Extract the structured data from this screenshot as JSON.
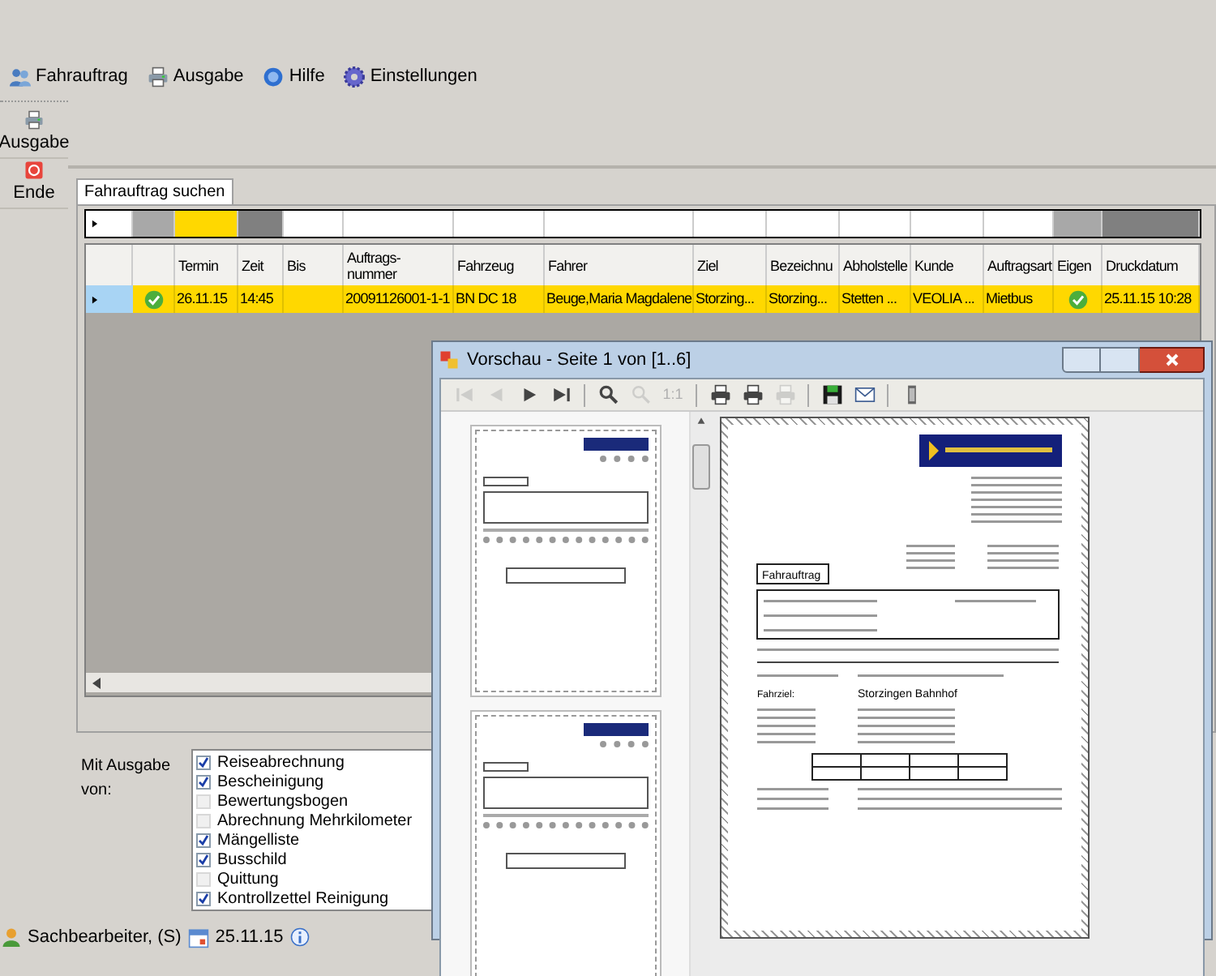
{
  "menu": [
    {
      "label": "Fahrauftrag"
    },
    {
      "label": "Ausgabe"
    },
    {
      "label": "Hilfe"
    },
    {
      "label": "Einstellungen"
    }
  ],
  "toolbar": [
    {
      "label": "Ausgabe"
    },
    {
      "label": "Ende"
    }
  ],
  "tabs": [
    {
      "label": "Fahrauftrag suchen",
      "selected": true
    }
  ],
  "filter_cells": [
    {
      "color": "#ffffff"
    },
    {
      "color": "#a8a8a8"
    },
    {
      "color": "#ffd800"
    },
    {
      "color": "#808080"
    },
    {
      "color": "#ffffff"
    },
    {
      "color": "#ffffff"
    },
    {
      "color": "#ffffff"
    },
    {
      "color": "#ffffff"
    },
    {
      "color": "#ffffff"
    },
    {
      "color": "#ffffff"
    },
    {
      "color": "#ffffff"
    },
    {
      "color": "#ffffff"
    },
    {
      "color": "#ffffff"
    },
    {
      "color": "#a8a8a8"
    },
    {
      "color": "#808080"
    }
  ],
  "table": {
    "columns": [
      {
        "kind": "check"
      },
      {
        "label": "Termin",
        "kind": "text"
      },
      {
        "label": "Zeit",
        "kind": "text"
      },
      {
        "label": "Bis",
        "kind": "text"
      },
      {
        "label": "Auftrags-nummer",
        "kind": "text"
      },
      {
        "label": "Fahrzeug",
        "kind": "text"
      },
      {
        "label": "Fahrer",
        "kind": "text"
      },
      {
        "label": "Ziel",
        "kind": "text"
      },
      {
        "label": "Bezeichnu",
        "kind": "text"
      },
      {
        "label": "Abholstelle",
        "kind": "text"
      },
      {
        "label": "Kunde",
        "kind": "text"
      },
      {
        "label": "Auftragsart",
        "kind": "text"
      },
      {
        "label": "Eigen",
        "kind": "check"
      },
      {
        "label": "Druckdatum",
        "kind": "text"
      }
    ],
    "rows": [
      {
        "selected": true,
        "cells": [
          {
            "checked": true
          },
          {
            "text": "26.11.15"
          },
          {
            "text": "14:45"
          },
          {},
          {
            "text": "20091126001-1-1"
          },
          {
            "text": "BN DC 18"
          },
          {
            "text": "Beuge,Maria Magdalene"
          },
          {
            "text": "Storzing..."
          },
          {
            "text": "Storzing..."
          },
          {
            "text": "Stetten ..."
          },
          {
            "text": "VEOLIA ..."
          },
          {
            "text": "Mietbus"
          },
          {
            "checked": true
          },
          {
            "text": "25.11.15 10:28"
          }
        ]
      }
    ]
  },
  "output_options": {
    "label": "Mit Ausgabe von:",
    "items": [
      {
        "label": "Reiseabrechnung",
        "checked": true
      },
      {
        "label": "Bescheinigung",
        "checked": true
      },
      {
        "label": "Bewertungsbogen",
        "checked": false
      },
      {
        "label": "Abrechnung Mehrkilometer",
        "checked": false
      },
      {
        "label": "Mängelliste",
        "checked": true
      },
      {
        "label": "Busschild",
        "checked": true
      },
      {
        "label": "Quittung",
        "checked": false
      },
      {
        "label": "Kontrollzettel Reinigung",
        "checked": true
      }
    ]
  },
  "status_bar": {
    "user": "Sachbearbeiter, (S)",
    "date": "25.11.15"
  },
  "preview": {
    "title": "Vorschau - Seite 1 von [1..6]",
    "tools": [
      {
        "kind": "first",
        "disabled": true
      },
      {
        "kind": "prev",
        "disabled": true
      },
      {
        "kind": "next",
        "disabled": false
      },
      {
        "kind": "last",
        "disabled": false
      },
      {
        "kind": "sep"
      },
      {
        "kind": "zoom-in",
        "disabled": false
      },
      {
        "kind": "zoom-out",
        "disabled": true
      },
      {
        "kind": "actual",
        "text": "1:1",
        "disabled": true
      },
      {
        "kind": "sep"
      },
      {
        "kind": "print",
        "disabled": false
      },
      {
        "kind": "print",
        "disabled": false
      },
      {
        "kind": "print",
        "disabled": true
      },
      {
        "kind": "sep"
      },
      {
        "kind": "save",
        "disabled": false
      },
      {
        "kind": "mail",
        "disabled": false
      },
      {
        "kind": "sep"
      },
      {
        "kind": "exit",
        "disabled": false
      }
    ],
    "document": {
      "heading": "Fahrauftrag",
      "goal_label": "Fahrziel:",
      "goal": "Storzingen Bahnhof"
    }
  }
}
